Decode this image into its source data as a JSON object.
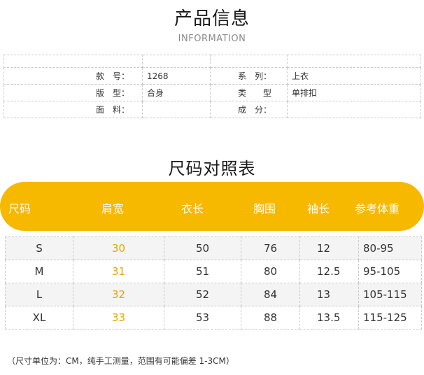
{
  "header": {
    "title": "产品信息",
    "subtitle": "INFORMATION"
  },
  "info": {
    "rows": [
      {
        "label1": "款　号：",
        "value1": "1268",
        "label2": "系　列：",
        "value2": "上衣"
      },
      {
        "label1": "版　型：",
        "value1": "合身",
        "label2": "类　　型",
        "value2": "单排扣"
      },
      {
        "label1": "面　料：",
        "value1": "",
        "label2": "成　分：",
        "value2": ""
      }
    ]
  },
  "size_chart": {
    "title": "尺码对照表",
    "headers": [
      "尺码",
      "肩宽",
      "衣长",
      "胸围",
      "袖长",
      "参考体重"
    ],
    "rows": [
      [
        "S",
        "30",
        "50",
        "76",
        "12",
        "80-95"
      ],
      [
        "M",
        "31",
        "51",
        "80",
        "12.5",
        "95-105"
      ],
      [
        "L",
        "32",
        "52",
        "84",
        "13",
        "105-115"
      ],
      [
        "XL",
        "33",
        "53",
        "88",
        "13.5",
        "115-125"
      ]
    ],
    "note": "（尺寸单位为：CM，纯手工测量，范围有可能偏差 1-3CM）"
  },
  "colors": {
    "accent": "#f7b800",
    "shoulder_text": "#e0a800"
  }
}
